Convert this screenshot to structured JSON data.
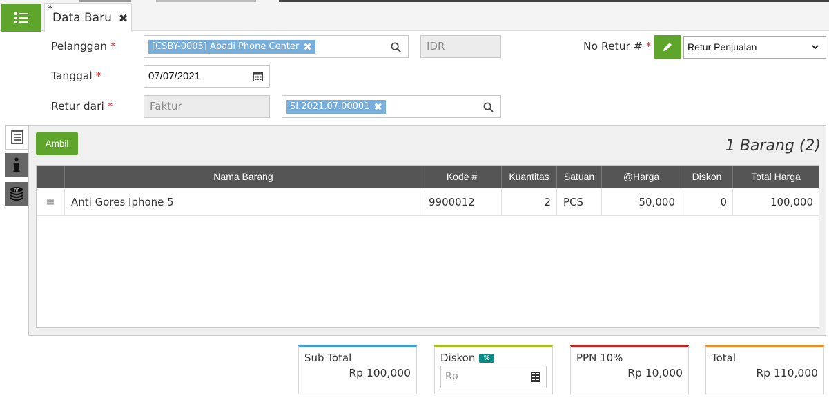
{
  "tab": {
    "modified_mark": "*",
    "title": "Data Baru",
    "close_label": "✖"
  },
  "form": {
    "customer": {
      "label": "Pelanggan",
      "required_mark": "*",
      "chip": "[CSBY-0005] Abadi Phone Center",
      "chip_remove": "✖"
    },
    "currency": {
      "value": "IDR"
    },
    "return_no": {
      "label": "No Retur #",
      "required_mark": "*",
      "type_selected": "Retur Penjualan"
    },
    "date": {
      "label": "Tanggal",
      "required_mark": "*",
      "value": "07/07/2021"
    },
    "return_from": {
      "label": "Retur dari",
      "required_mark": "*",
      "type_value": "Faktur",
      "chip": "SI.2021.07.00001",
      "chip_remove": "✖"
    }
  },
  "items": {
    "take_button": "Ambil",
    "count_label": "1 Barang (2)",
    "columns": [
      "Nama Barang",
      "Kode #",
      "Kuantitas",
      "Satuan",
      "@Harga",
      "Diskon",
      "Total Harga"
    ],
    "rows": [
      {
        "handle": "≡",
        "name": "Anti Gores Iphone 5",
        "code": "9900012",
        "qty": "2",
        "unit": "PCS",
        "price": "50,000",
        "discount": "0",
        "total": "100,000"
      }
    ]
  },
  "summary": {
    "subtotal": {
      "label": "Sub Total",
      "value": "Rp 100,000",
      "color": "#3fa2da"
    },
    "discount": {
      "label": "Diskon",
      "badge": "%",
      "placeholder": "Rp",
      "color": "#a6c31a"
    },
    "tax": {
      "label": "PPN 10%",
      "value": "Rp 10,000",
      "color": "#cc1f1f"
    },
    "total": {
      "label": "Total",
      "value": "Rp 110,000",
      "color": "#f08a24"
    }
  },
  "colors": {
    "accent_green": "#5fa52b",
    "header_dark": "#555555",
    "chip_blue": "#78aedb"
  },
  "icons": [
    "list-menu-icon",
    "search-icon",
    "calendar-icon",
    "pencil-icon",
    "chevron-down-icon",
    "document-list-icon",
    "info-icon",
    "rp-coins-icon",
    "drag-handle-icon",
    "calculator-icon"
  ]
}
